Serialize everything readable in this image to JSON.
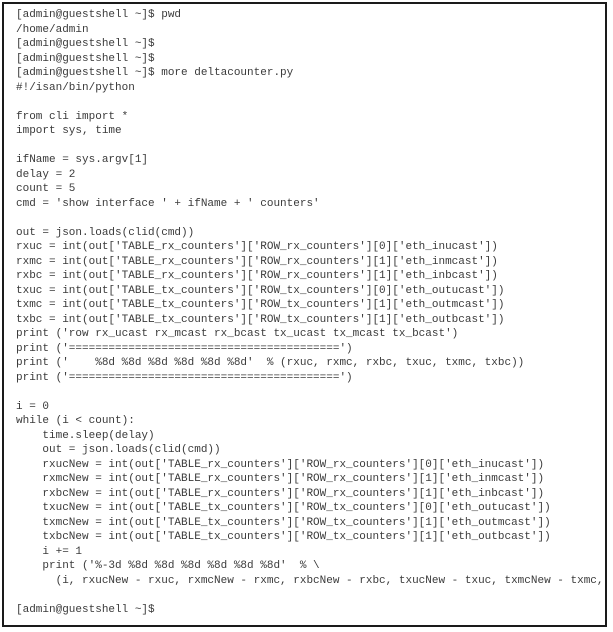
{
  "terminal": {
    "prompt": "[admin@guestshell ~]$",
    "lines": [
      "[admin@guestshell ~]$ pwd",
      "/home/admin",
      "[admin@guestshell ~]$",
      "[admin@guestshell ~]$",
      "[admin@guestshell ~]$ more deltacounter.py",
      "#!/isan/bin/python",
      "",
      "from cli import *",
      "import sys, time",
      "",
      "ifName = sys.argv[1]",
      "delay = 2",
      "count = 5",
      "cmd = 'show interface ' + ifName + ' counters'",
      "",
      "out = json.loads(clid(cmd))",
      "rxuc = int(out['TABLE_rx_counters']['ROW_rx_counters'][0]['eth_inucast'])",
      "rxmc = int(out['TABLE_rx_counters']['ROW_rx_counters'][1]['eth_inmcast'])",
      "rxbc = int(out['TABLE_rx_counters']['ROW_rx_counters'][1]['eth_inbcast'])",
      "txuc = int(out['TABLE_tx_counters']['ROW_tx_counters'][0]['eth_outucast'])",
      "txmc = int(out['TABLE_tx_counters']['ROW_tx_counters'][1]['eth_outmcast'])",
      "txbc = int(out['TABLE_tx_counters']['ROW_tx_counters'][1]['eth_outbcast'])",
      "print ('row rx_ucast rx_mcast rx_bcast tx_ucast tx_mcast tx_bcast')",
      "print ('=========================================')",
      "print ('    %8d %8d %8d %8d %8d %8d'  % (rxuc, rxmc, rxbc, txuc, txmc, txbc))",
      "print ('=========================================')",
      "",
      "i = 0",
      "while (i < count):",
      "    time.sleep(delay)",
      "    out = json.loads(clid(cmd))",
      "    rxucNew = int(out['TABLE_rx_counters']['ROW_rx_counters'][0]['eth_inucast'])",
      "    rxmcNew = int(out['TABLE_rx_counters']['ROW_rx_counters'][1]['eth_inmcast'])",
      "    rxbcNew = int(out['TABLE_rx_counters']['ROW_rx_counters'][1]['eth_inbcast'])",
      "    txucNew = int(out['TABLE_tx_counters']['ROW_tx_counters'][0]['eth_outucast'])",
      "    txmcNew = int(out['TABLE_tx_counters']['ROW_tx_counters'][1]['eth_outmcast'])",
      "    txbcNew = int(out['TABLE_tx_counters']['ROW_tx_counters'][1]['eth_outbcast'])",
      "    i += 1",
      "    print ('%-3d %8d %8d %8d %8d %8d %8d'  % \\",
      "      (i, rxucNew - rxuc, rxmcNew - rxmc, rxbcNew - rxbc, txucNew - txuc, txmcNew - txmc,",
      "",
      "[admin@guestshell ~]$"
    ]
  }
}
